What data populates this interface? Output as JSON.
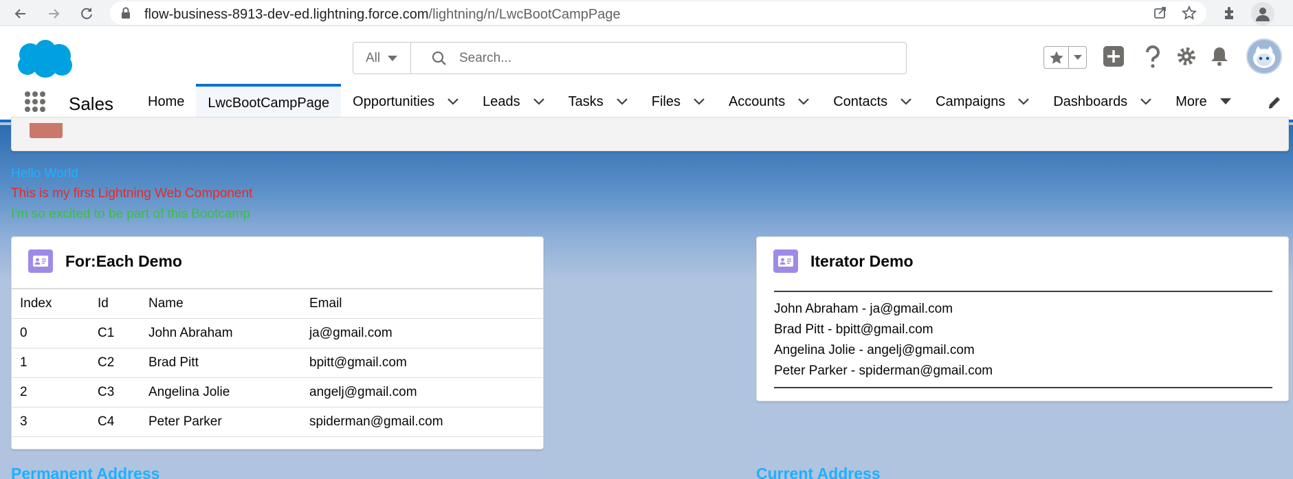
{
  "browser": {
    "url_host": "flow-business-8913-dev-ed.lightning.force.com",
    "url_path": "/lightning/n/LwcBootCampPage"
  },
  "header": {
    "search_scope": "All",
    "search_placeholder": "Search..."
  },
  "nav": {
    "app_name": "Sales",
    "items": [
      {
        "label": "Home",
        "dropdown": false,
        "active": false
      },
      {
        "label": "LwcBootCampPage",
        "dropdown": false,
        "active": true
      },
      {
        "label": "Opportunities",
        "dropdown": true
      },
      {
        "label": "Leads",
        "dropdown": true
      },
      {
        "label": "Tasks",
        "dropdown": true
      },
      {
        "label": "Files",
        "dropdown": true
      },
      {
        "label": "Accounts",
        "dropdown": true
      },
      {
        "label": "Contacts",
        "dropdown": true
      },
      {
        "label": "Campaigns",
        "dropdown": true
      },
      {
        "label": "Dashboards",
        "dropdown": true
      },
      {
        "label": "More",
        "dropdown": true
      }
    ]
  },
  "page_header": {
    "title": "LwcBootCampPage"
  },
  "messages": {
    "hello": "Hello World",
    "first": "This is my first Lightning Web Component",
    "excited": "I'm so excited to be part of this Bootcamp"
  },
  "foreach_card": {
    "title": "For:Each Demo",
    "columns": [
      "Index",
      "Id",
      "Name",
      "Email"
    ],
    "rows": [
      [
        "0",
        "C1",
        "John Abraham",
        "ja@gmail.com"
      ],
      [
        "1",
        "C2",
        "Brad Pitt",
        "bpitt@gmail.com"
      ],
      [
        "2",
        "C3",
        "Angelina Jolie",
        "angelj@gmail.com"
      ],
      [
        "3",
        "C4",
        "Peter Parker",
        "spiderman@gmail.com"
      ]
    ]
  },
  "iterator_card": {
    "title": "Iterator Demo",
    "items": [
      "John Abraham - ja@gmail.com",
      "Brad Pitt - bpitt@gmail.com",
      "Angelina Jolie - angelj@gmail.com",
      "Peter Parker - spiderman@gmail.com"
    ]
  },
  "sections": {
    "permanent_address": "Permanent Address",
    "current_address": "Current Address"
  },
  "colors": {
    "brand": "#0070d2",
    "hello": "#1fb0ff",
    "first": "#e32a2a",
    "excited": "#36c13d",
    "card_icon": "#9f8be7"
  }
}
